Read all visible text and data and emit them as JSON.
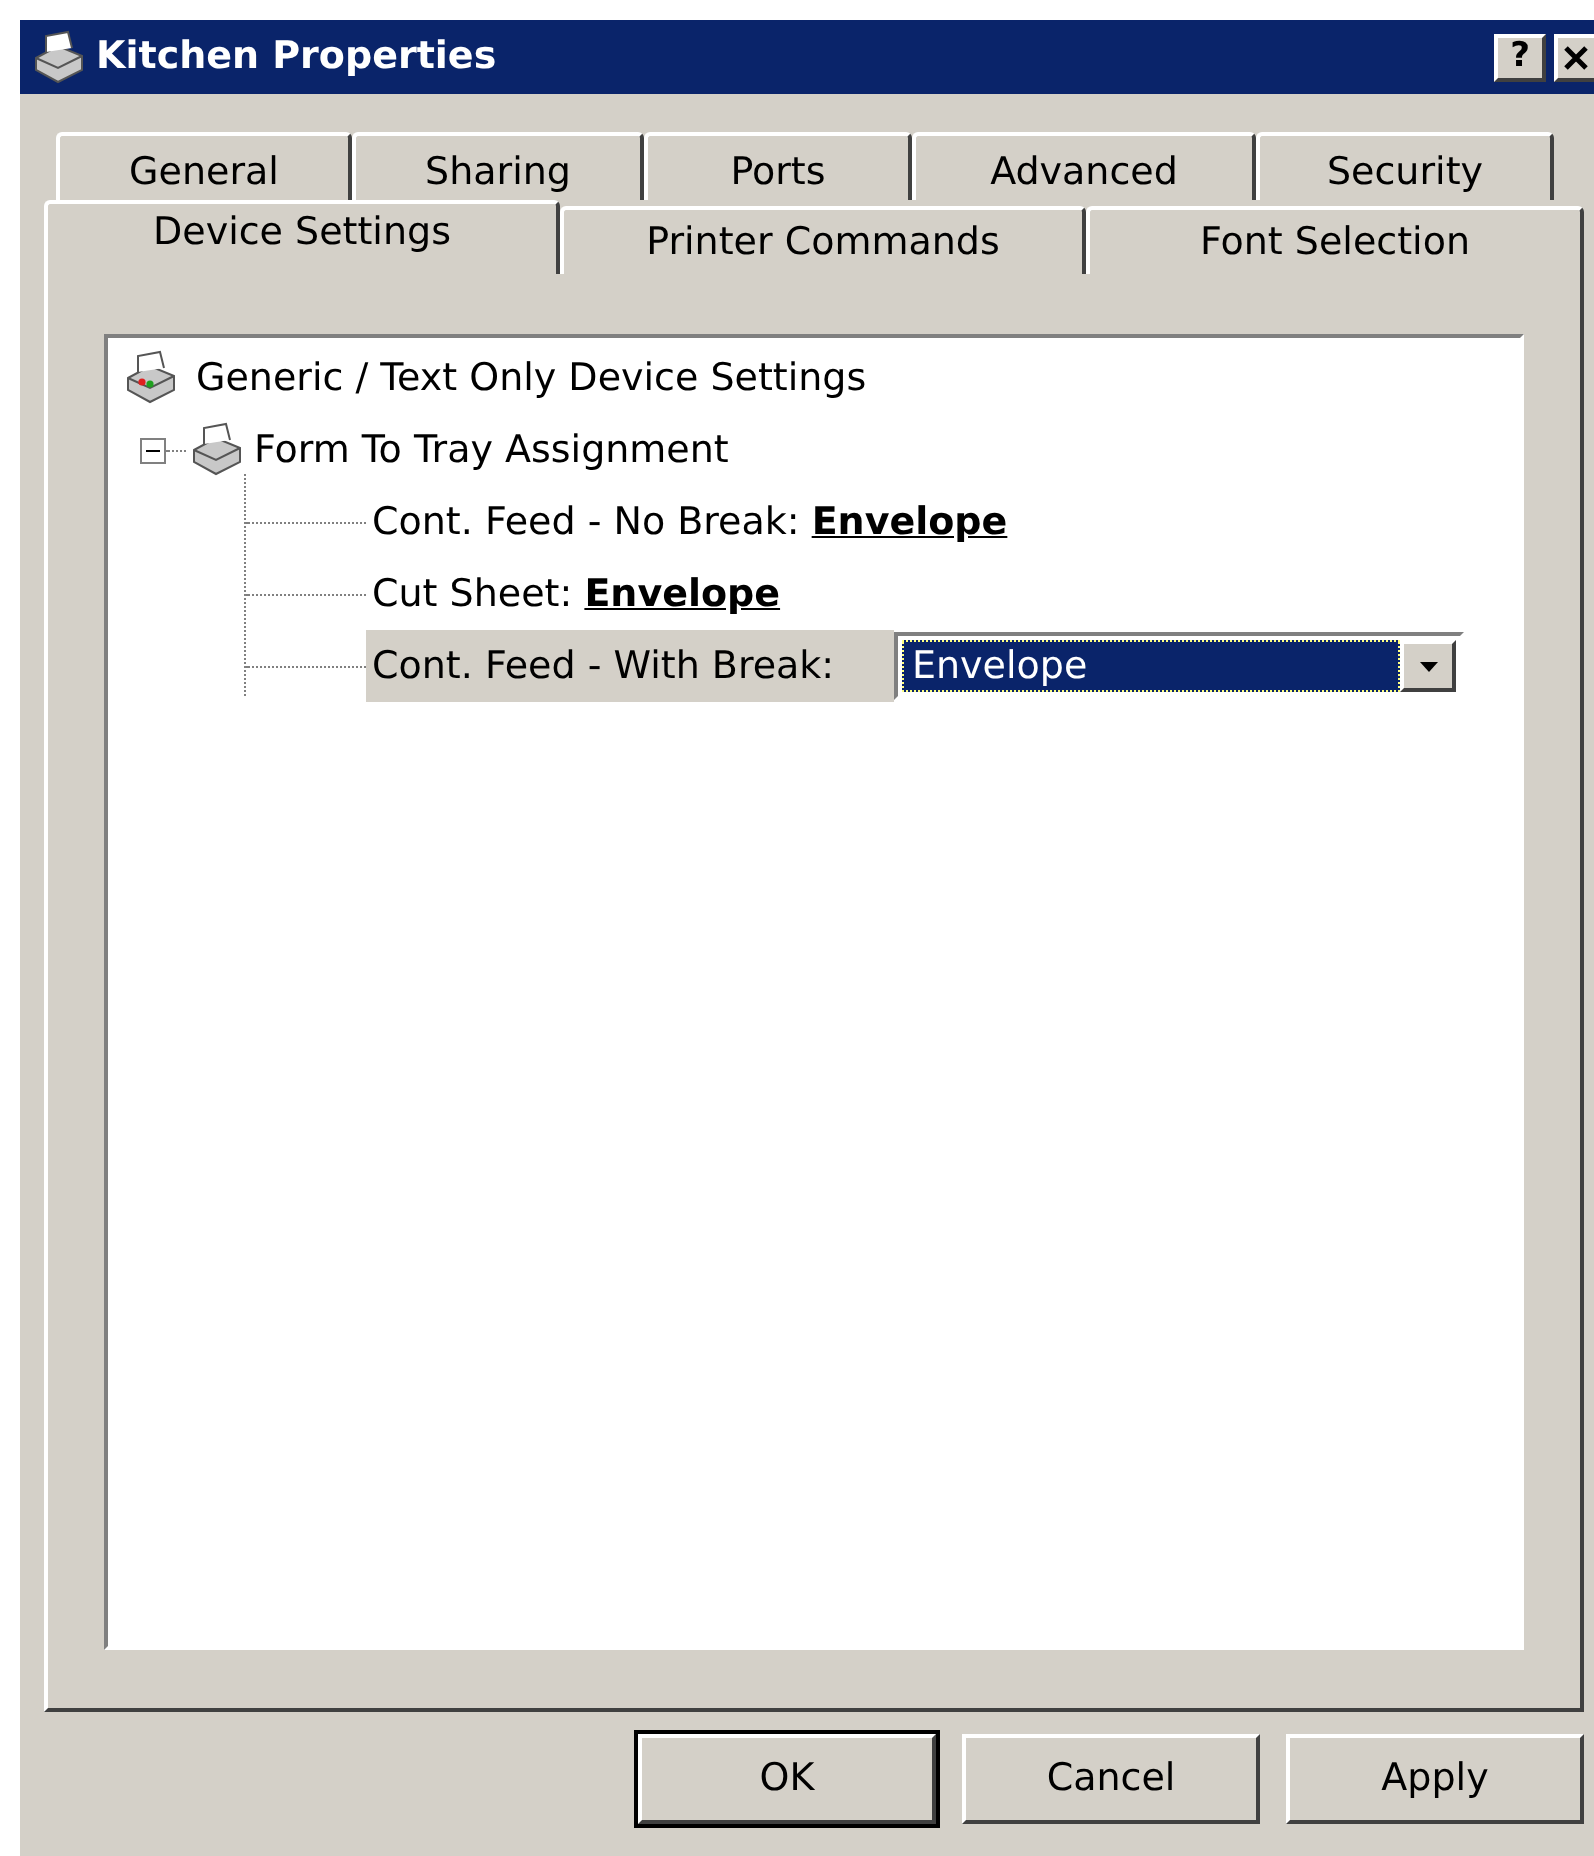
{
  "window": {
    "title": "Kitchen Properties",
    "help_button": "?"
  },
  "tabs": [
    [
      {
        "label": "General",
        "selected": false
      },
      {
        "label": "Sharing",
        "selected": false
      },
      {
        "label": "Ports",
        "selected": false
      },
      {
        "label": "Advanced",
        "selected": false
      },
      {
        "label": "Security",
        "selected": false
      }
    ],
    [
      {
        "label": "Device Settings",
        "selected": true
      },
      {
        "label": "Printer Commands",
        "selected": false
      },
      {
        "label": "Font Selection",
        "selected": false
      }
    ]
  ],
  "tree": {
    "label": "Generic / Text Only Device Settings",
    "children": [
      {
        "label": "Form To Tray Assignment",
        "expanded": true,
        "children": [
          {
            "kind": "value",
            "label": "Cont. Feed - No Break:",
            "value": "Envelope",
            "selected": false
          },
          {
            "kind": "value",
            "label": "Cut Sheet:",
            "value": "Envelope",
            "selected": false
          },
          {
            "kind": "dropdown",
            "label": "Cont. Feed - With Break:",
            "value": "Envelope",
            "selected": true
          }
        ]
      }
    ]
  },
  "buttons": [
    {
      "label": "OK",
      "default": true
    },
    {
      "label": "Cancel",
      "default": false
    },
    {
      "label": "Apply",
      "default": false
    }
  ]
}
